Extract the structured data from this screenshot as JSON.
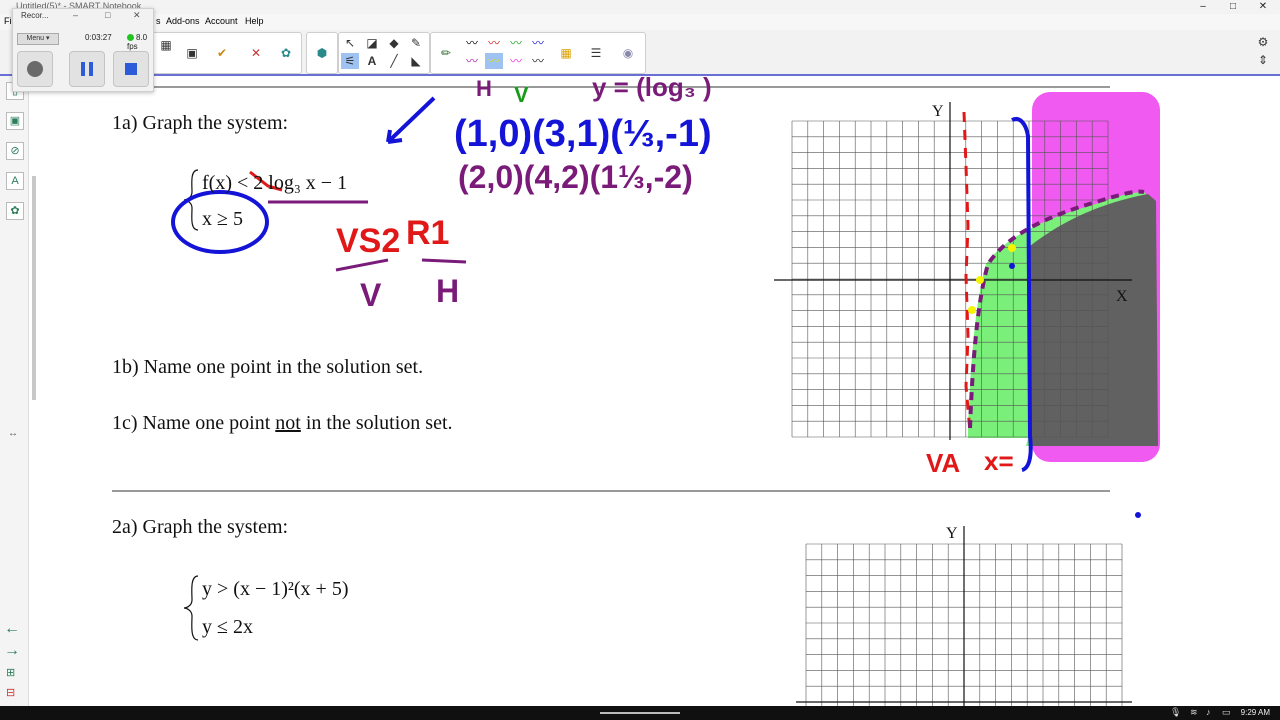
{
  "window": {
    "title": "Untitled(5)* - SMART Notebook",
    "minimize": "–",
    "maximize": "□",
    "close": "✕"
  },
  "menu": {
    "file": "Fi",
    "view_tail": "s",
    "addons": "Add-ons",
    "account": "Account",
    "help": "Help"
  },
  "recorder": {
    "title": "Recor...",
    "min": "–",
    "restore": "□",
    "close": "✕",
    "menu_label": "Menu ▾",
    "time": "0:03:27",
    "fps": "8.0 fps",
    "status_color": "#21c421"
  },
  "page": {
    "q1a": "1a) Graph the system:",
    "q1b": "1b) Name one point in the solution set.",
    "q1c_pre": "1c) Name one point ",
    "q1c_not": "not",
    "q1c_post": " in the solution set.",
    "q2a": "2a) Graph the system:",
    "sys1_line1": "f(x) < 2 log₃ x − 1",
    "sys1_line2": "x ≥ 5",
    "sys2_line1": "y > (x − 1)²(x + 5)",
    "sys2_line2": "y ≤ 2x"
  },
  "graph1": {
    "x_label": "X",
    "y_label": "Y"
  },
  "graph2": {
    "y_label": "Y"
  },
  "annotations": {
    "top_eq": "y = (log₃ )",
    "h_mark": "H",
    "v_mark": "V",
    "pts_row1": "(1,0)(3,1)(⅓,-1)",
    "pts_row2": "(2,0)(4,2)(1⅓,-2)",
    "vs2": "VS2",
    "r1": "R1",
    "v": "V",
    "h": "H",
    "va": "VA",
    "x_eq": "x="
  },
  "colors": {
    "ink_purple": "#7a1b7a",
    "ink_blue": "#1414d8",
    "ink_green": "#1a9a1a",
    "ink_red": "#e01818",
    "fill_magenta": "#f05af0",
    "fill_green": "#7af07a",
    "fill_gray": "#616161",
    "highlight_yellow": "#f5f500",
    "accent": "#6a6fd6"
  },
  "taskbar": {
    "time": "9:29 AM"
  }
}
